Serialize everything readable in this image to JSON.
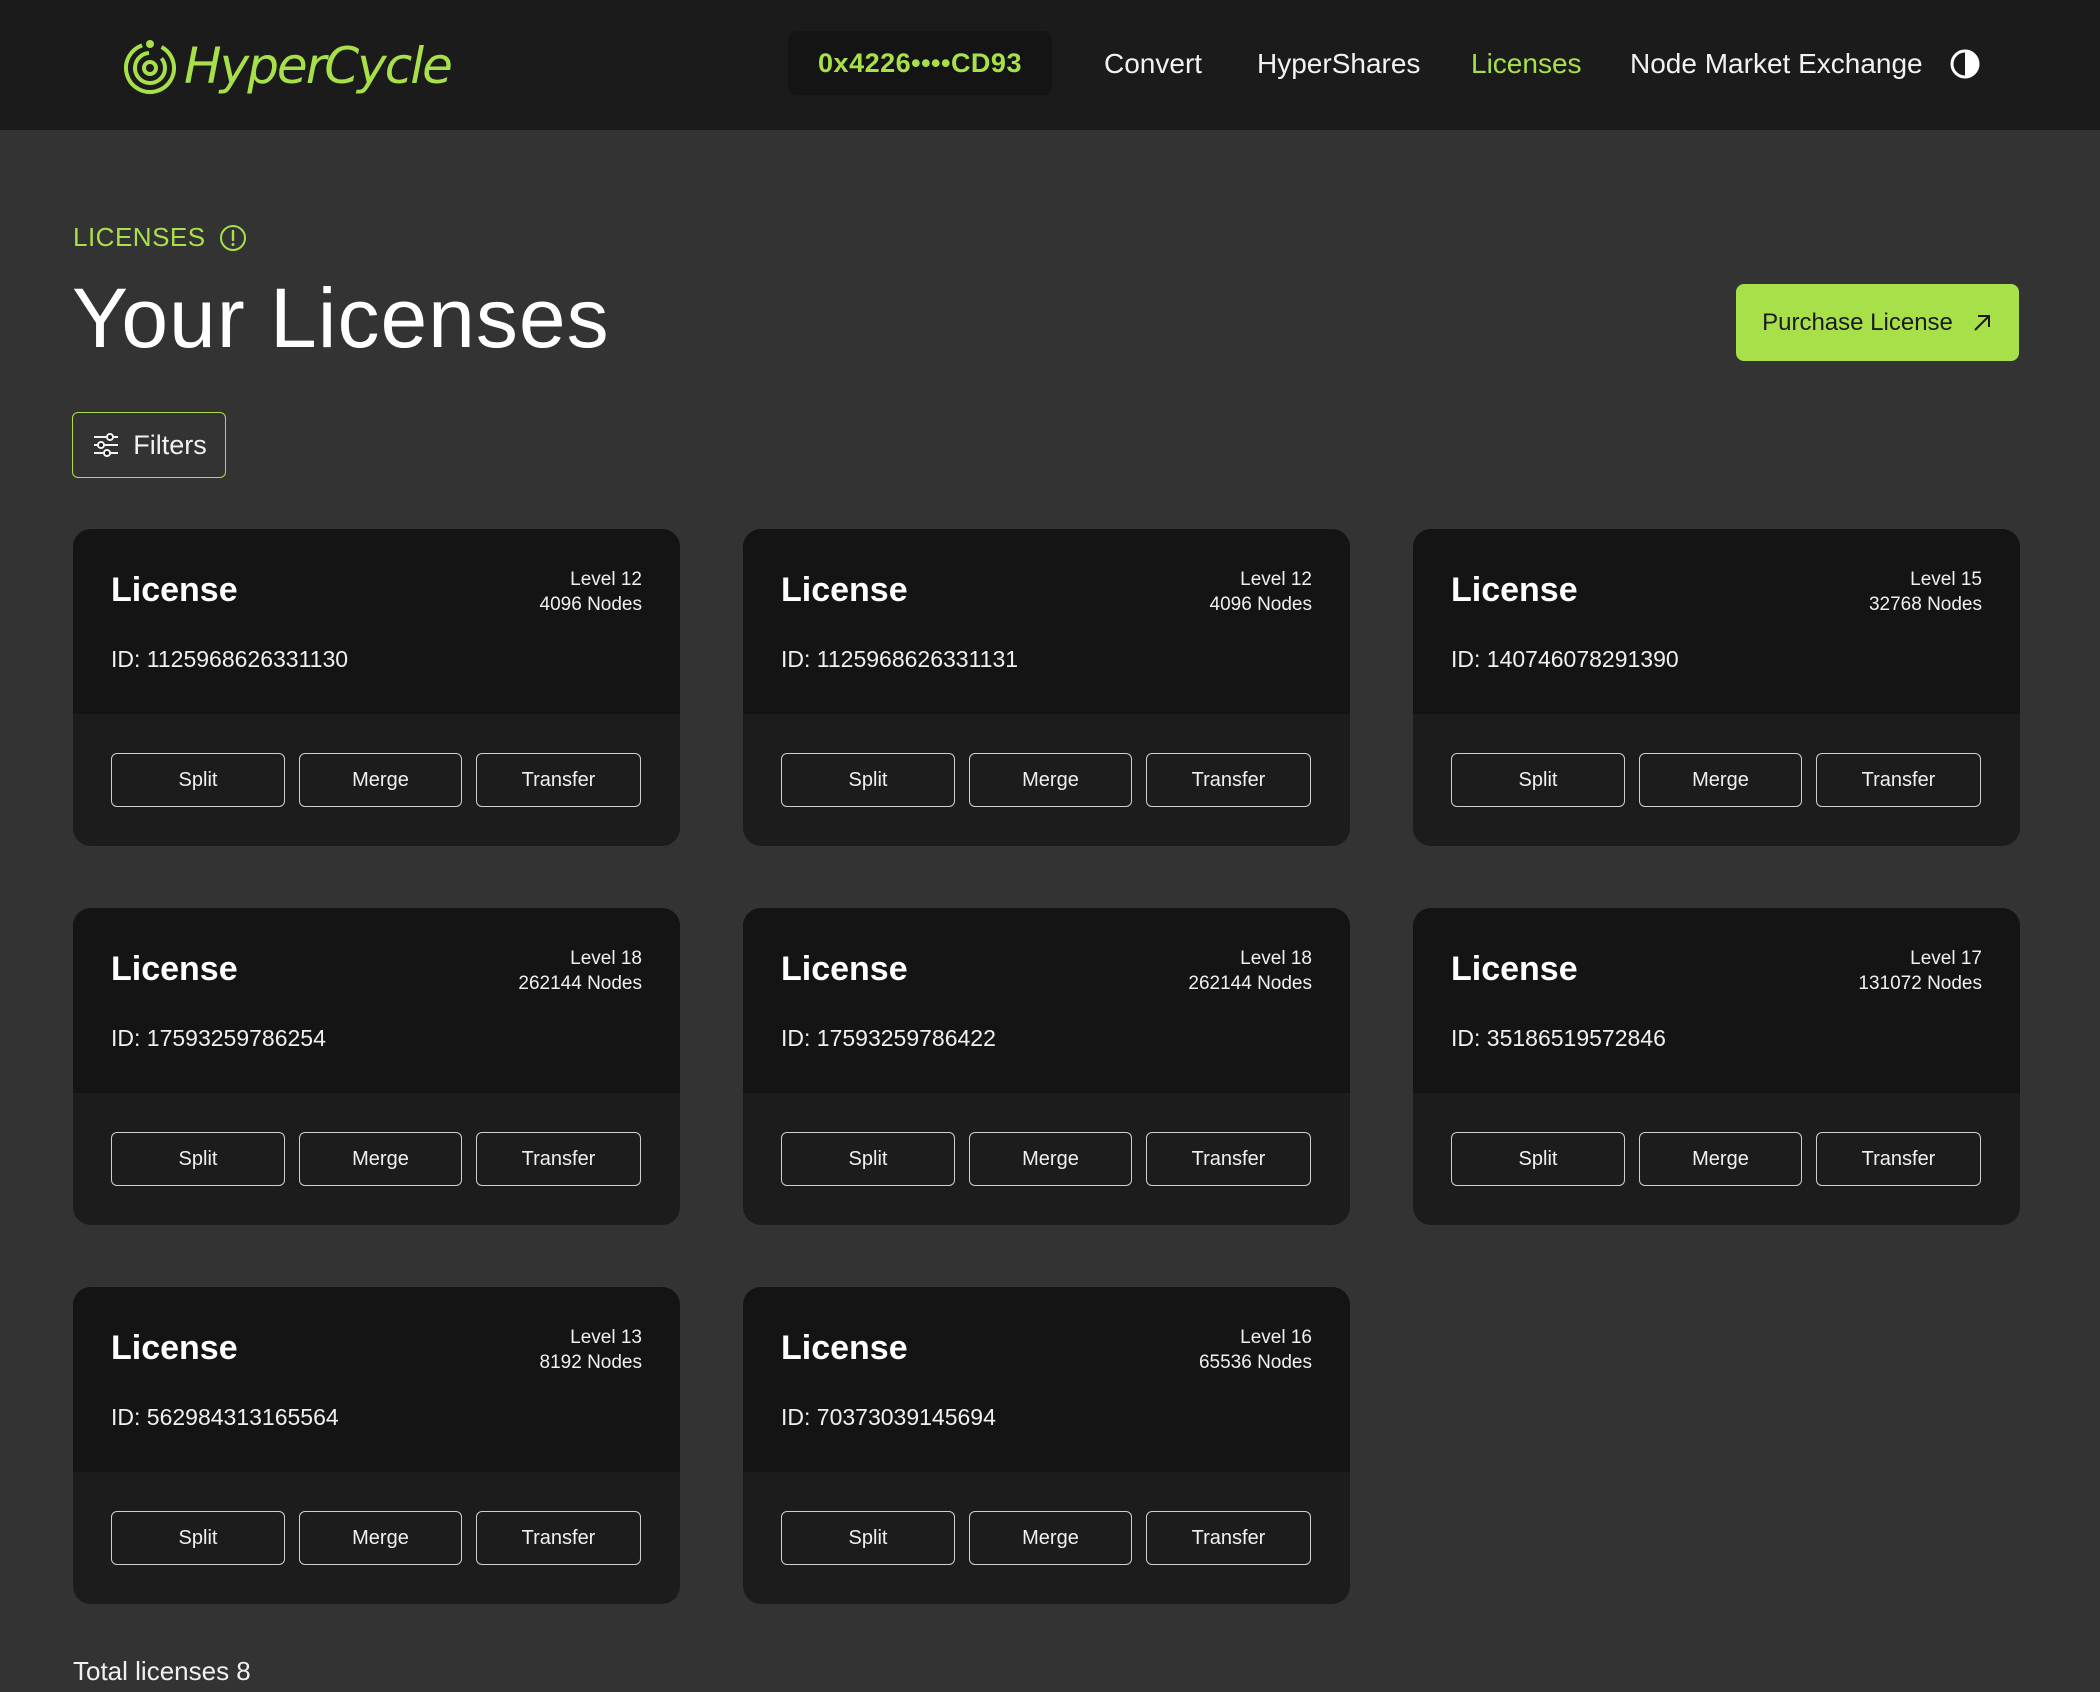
{
  "header": {
    "logo_text": "HyperCycle",
    "wallet": "0x4226••••CD93",
    "nav": [
      {
        "label": "Convert",
        "active": false
      },
      {
        "label": "HyperShares",
        "active": false
      },
      {
        "label": "Licenses",
        "active": true
      },
      {
        "label": "Node Market Exchange",
        "active": false
      }
    ],
    "theme_icon": "contrast-icon"
  },
  "page": {
    "section_label": "LICENSES",
    "section_icon": "info-icon",
    "title": "Your Licenses",
    "purchase_label": "Purchase License",
    "purchase_icon": "arrow-up-right-icon",
    "filters_label": "Filters",
    "filters_icon": "sliders-icon",
    "total_text": "Total licenses 8"
  },
  "licenses": [
    {
      "title": "License",
      "level": "Level 12",
      "nodes": "4096 Nodes",
      "id": "ID: 1125968626331130"
    },
    {
      "title": "License",
      "level": "Level 12",
      "nodes": "4096 Nodes",
      "id": "ID: 1125968626331131"
    },
    {
      "title": "License",
      "level": "Level 15",
      "nodes": "32768 Nodes",
      "id": "ID: 140746078291390"
    },
    {
      "title": "License",
      "level": "Level 18",
      "nodes": "262144 Nodes",
      "id": "ID: 17593259786254"
    },
    {
      "title": "License",
      "level": "Level 18",
      "nodes": "262144 Nodes",
      "id": "ID: 17593259786422"
    },
    {
      "title": "License",
      "level": "Level 17",
      "nodes": "131072 Nodes",
      "id": "ID: 35186519572846"
    },
    {
      "title": "License",
      "level": "Level 13",
      "nodes": "8192 Nodes",
      "id": "ID: 562984313165564"
    },
    {
      "title": "License",
      "level": "Level 16",
      "nodes": "65536 Nodes",
      "id": "ID: 70373039145694"
    }
  ],
  "card_actions": {
    "split": "Split",
    "merge": "Merge",
    "transfer": "Transfer"
  },
  "colors": {
    "accent": "#a8e04a",
    "background": "#333333",
    "header": "#1b1b1b",
    "card": "#1c1c1d"
  }
}
